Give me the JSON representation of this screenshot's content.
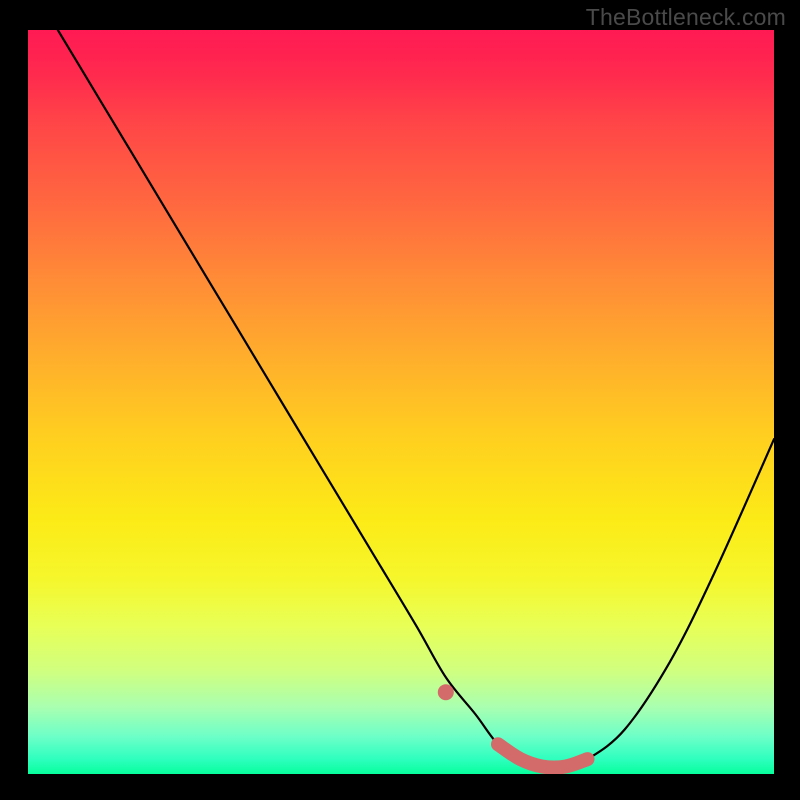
{
  "watermark": "TheBottleneck.com",
  "chart_data": {
    "type": "line",
    "title": "",
    "xlabel": "",
    "ylabel": "",
    "xlim": [
      0,
      100
    ],
    "ylim": [
      0,
      100
    ],
    "grid": false,
    "legend": false,
    "annotations": [],
    "series": [
      {
        "name": "bottleneck-curve",
        "color": "#000000",
        "x": [
          4,
          10,
          16,
          22,
          28,
          34,
          40,
          46,
          52,
          56,
          60,
          63,
          66,
          69,
          72,
          75,
          80,
          86,
          92,
          100
        ],
        "values": [
          100,
          90,
          80,
          70,
          60,
          50,
          40,
          30,
          20,
          13,
          8,
          4,
          2,
          1,
          1,
          2,
          6,
          15,
          27,
          45
        ]
      }
    ],
    "highlight": {
      "name": "optimal-range",
      "color": "#d46b6b",
      "x": [
        56,
        63,
        66,
        69,
        72,
        75
      ],
      "values": [
        11,
        4,
        2,
        1,
        1,
        2
      ]
    }
  }
}
